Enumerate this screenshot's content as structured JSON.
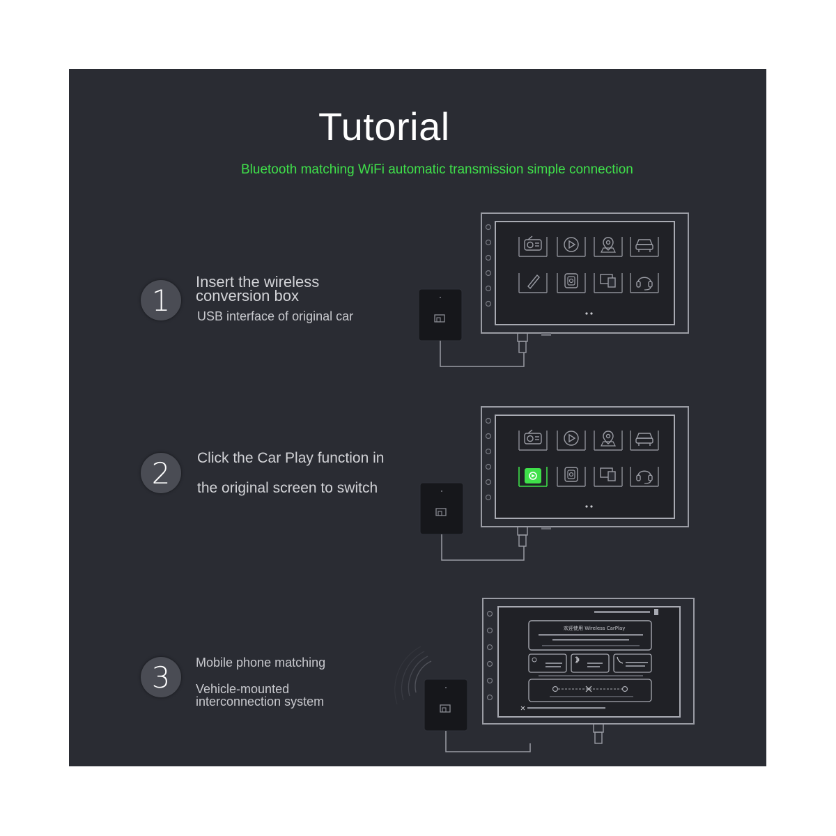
{
  "header": {
    "title": "Tutorial",
    "subtitle": "Bluetooth matching WiFi automatic transmission simple connection"
  },
  "steps": [
    {
      "number": "1",
      "line1": "Insert the wireless",
      "line2": "conversion box",
      "line3": "USB interface of original car"
    },
    {
      "number": "2",
      "line1": "Click the Car Play function in",
      "line2": "the original screen to switch"
    },
    {
      "number": "3",
      "line1": "Mobile phone matching",
      "line2": "Vehicle-mounted",
      "line3": "interconnection system"
    }
  ],
  "screen3": {
    "welcome": "欢迎使用 Wireless CarPlay"
  },
  "colors": {
    "background": "#2a2c33",
    "accent_green": "#3fe04a",
    "text": "#d2d3d7"
  },
  "icons": [
    "radio-icon",
    "play-icon",
    "map-pin-icon",
    "car-icon",
    "phone-icon",
    "carplay-icon",
    "mirror-icon",
    "headset-icon",
    "dongle-icon",
    "bluetooth-icon",
    "wifi-signal-icon"
  ]
}
